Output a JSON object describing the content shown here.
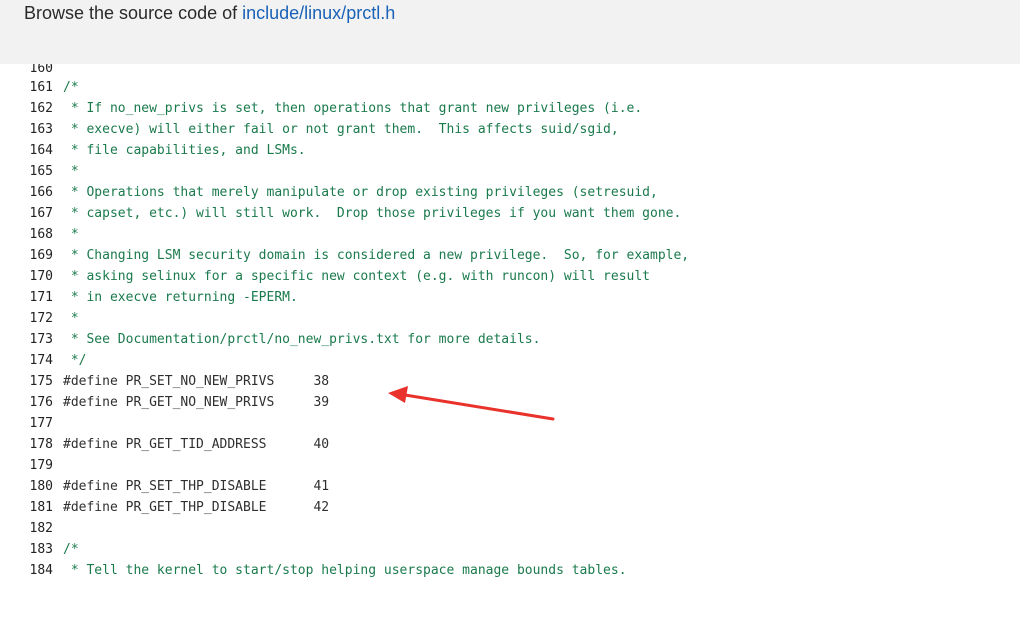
{
  "header": {
    "prefix": "Browse the source code of ",
    "path": "include/linux/prctl.h"
  },
  "code": {
    "partial_top": {
      "no": "160",
      "text": ""
    },
    "lines": [
      {
        "no": "161",
        "text": "/*",
        "kind": "comment"
      },
      {
        "no": "162",
        "text": " * If no_new_privs is set, then operations that grant new privileges (i.e.",
        "kind": "comment"
      },
      {
        "no": "163",
        "text": " * execve) will either fail or not grant them.  This affects suid/sgid,",
        "kind": "comment"
      },
      {
        "no": "164",
        "text": " * file capabilities, and LSMs.",
        "kind": "comment"
      },
      {
        "no": "165",
        "text": " *",
        "kind": "comment"
      },
      {
        "no": "166",
        "text": " * Operations that merely manipulate or drop existing privileges (setresuid,",
        "kind": "comment"
      },
      {
        "no": "167",
        "text": " * capset, etc.) will still work.  Drop those privileges if you want them gone.",
        "kind": "comment"
      },
      {
        "no": "168",
        "text": " *",
        "kind": "comment"
      },
      {
        "no": "169",
        "text": " * Changing LSM security domain is considered a new privilege.  So, for example,",
        "kind": "comment"
      },
      {
        "no": "170",
        "text": " * asking selinux for a specific new context (e.g. with runcon) will result",
        "kind": "comment"
      },
      {
        "no": "171",
        "text": " * in execve returning -EPERM.",
        "kind": "comment"
      },
      {
        "no": "172",
        "text": " *",
        "kind": "comment"
      },
      {
        "no": "173",
        "text": " * See Documentation/prctl/no_new_privs.txt for more details.",
        "kind": "comment"
      },
      {
        "no": "174",
        "text": " */",
        "kind": "comment"
      },
      {
        "no": "175",
        "text": "#define PR_SET_NO_NEW_PRIVS     38",
        "kind": "define"
      },
      {
        "no": "176",
        "text": "#define PR_GET_NO_NEW_PRIVS     39",
        "kind": "define"
      },
      {
        "no": "177",
        "text": "",
        "kind": "blank"
      },
      {
        "no": "178",
        "text": "#define PR_GET_TID_ADDRESS      40",
        "kind": "define"
      },
      {
        "no": "179",
        "text": "",
        "kind": "blank"
      },
      {
        "no": "180",
        "text": "#define PR_SET_THP_DISABLE      41",
        "kind": "define"
      },
      {
        "no": "181",
        "text": "#define PR_GET_THP_DISABLE      42",
        "kind": "define"
      },
      {
        "no": "182",
        "text": "",
        "kind": "blank"
      },
      {
        "no": "183",
        "text": "/*",
        "kind": "comment"
      },
      {
        "no": "184",
        "text": " * Tell the kernel to start/stop helping userspace manage bounds tables.",
        "kind": "comment"
      }
    ]
  },
  "annotation": {
    "arrow_color": "#e8322b"
  }
}
